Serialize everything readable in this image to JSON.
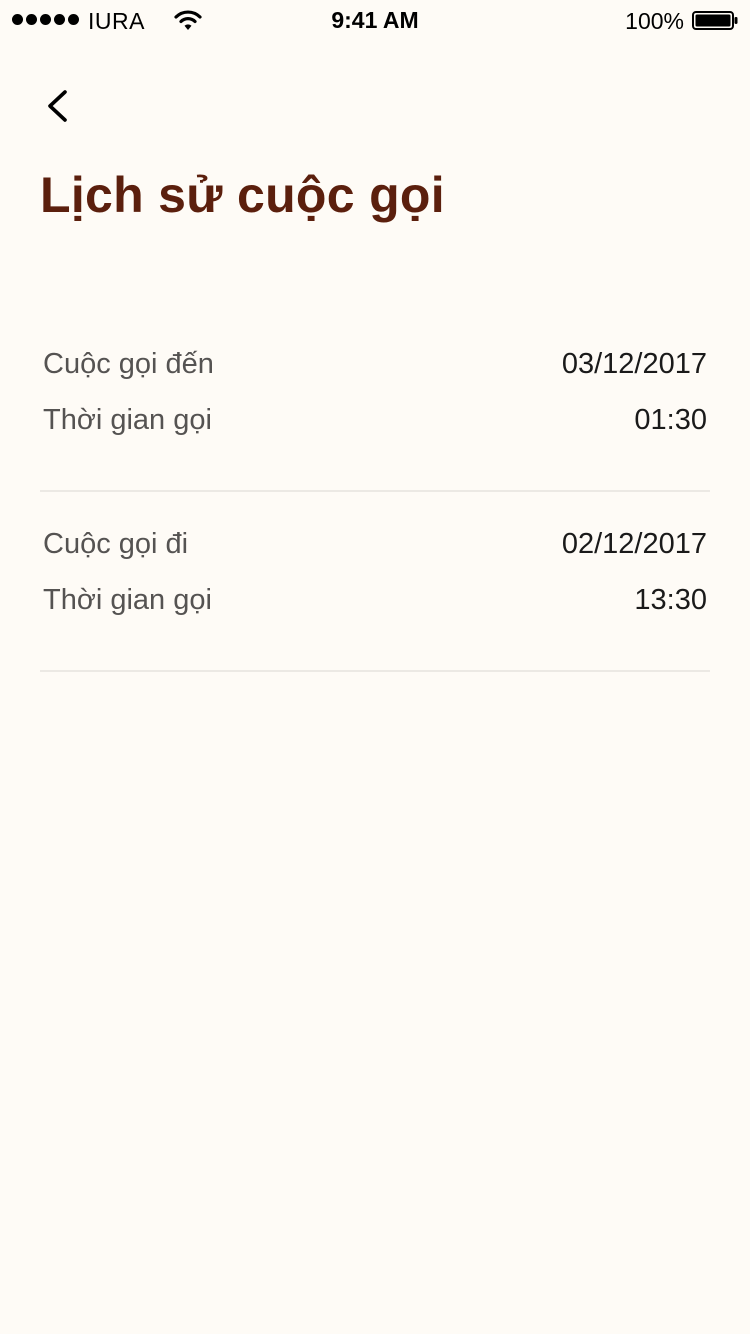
{
  "status_bar": {
    "carrier": "IURA",
    "time": "9:41 AM",
    "battery": "100%"
  },
  "nav": {
    "back_icon": "chevron-left-icon"
  },
  "title": "Lịch sử cuộc gọi",
  "records": [
    {
      "type_label": "Cuộc gọi đến",
      "date": "03/12/2017",
      "duration_label": "Thời gian gọi",
      "duration": "01:30"
    },
    {
      "type_label": "Cuộc gọi đi",
      "date": "02/12/2017",
      "duration_label": "Thời gian gọi",
      "duration": "13:30"
    }
  ],
  "colors": {
    "background": "#fefbf6",
    "title": "#5b1f0d",
    "label": "#555352",
    "value": "#1a1a1a",
    "divider": "#ece9e4"
  }
}
